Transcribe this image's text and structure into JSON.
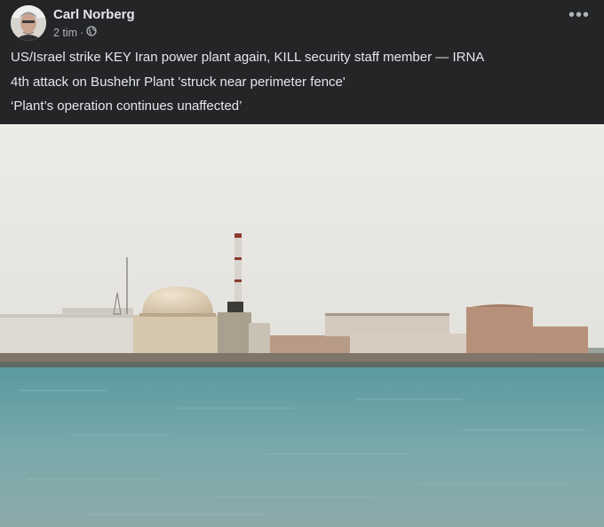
{
  "post": {
    "author": "Carl Norberg",
    "time": "2 tim",
    "separator": "·",
    "audience_icon": "globe-icon",
    "more_icon": "more-options-icon",
    "more_label": "•••",
    "lines": [
      "US/Israel strike KEY Iran power plant again, KILL security staff member — IRNA",
      "4th attack on Bushehr Plant 'struck near perimeter fence'",
      "‘Plant’s operation continues unaffected’"
    ]
  },
  "colors": {
    "background": "#242526",
    "primary_text": "#e4e6eb",
    "secondary_text": "#b0b3b8",
    "sky": "#e9e7e3",
    "sea": "#6fa0a3"
  }
}
